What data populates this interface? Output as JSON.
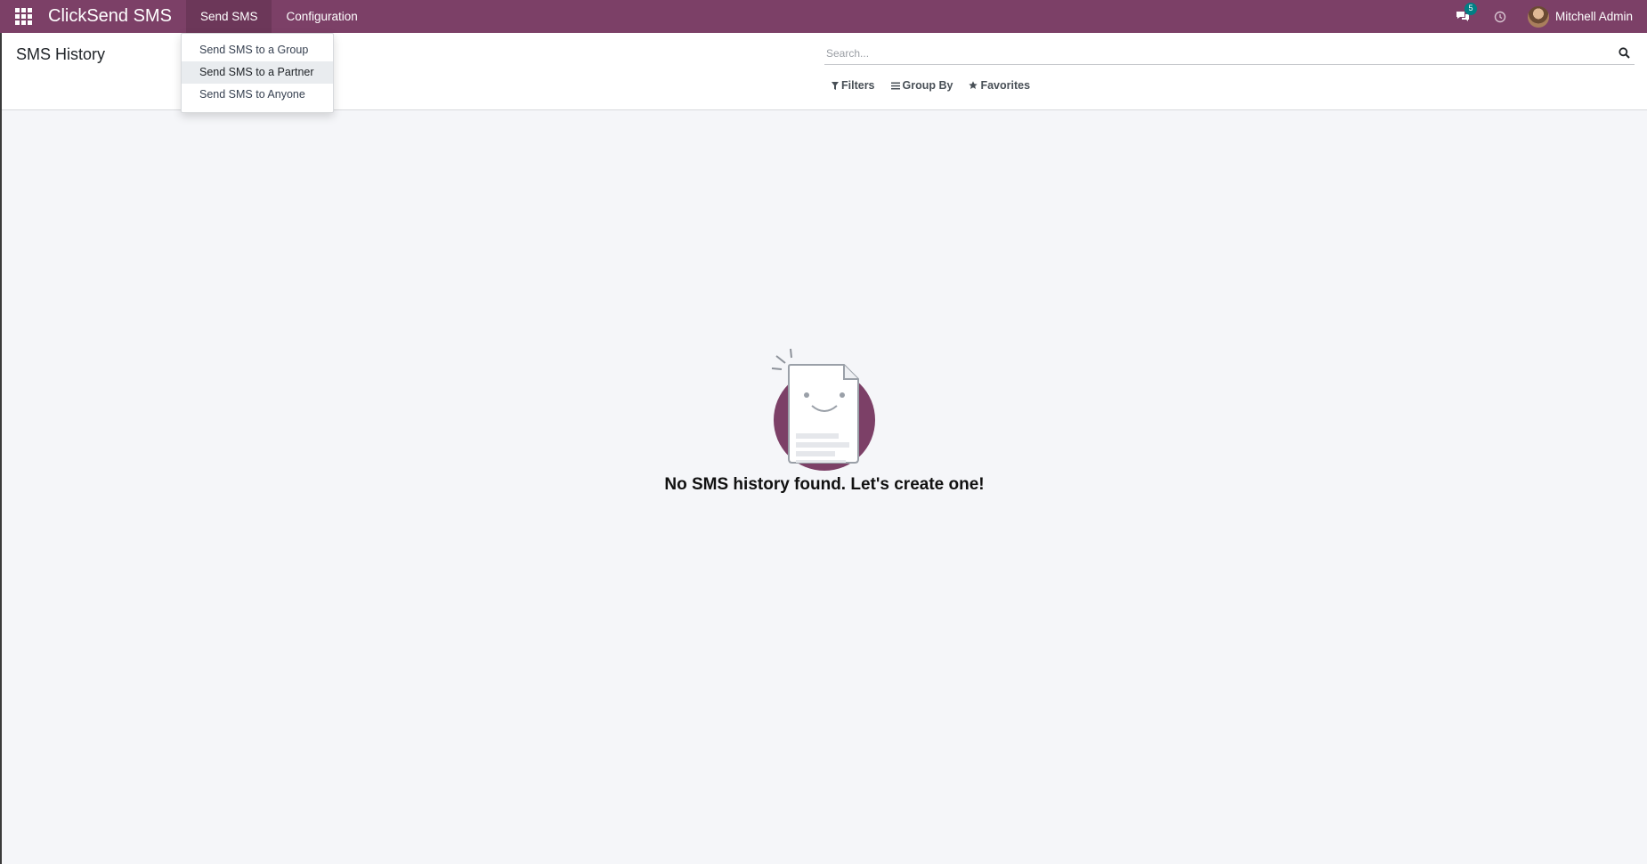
{
  "app": {
    "brand": "ClickSend SMS"
  },
  "navbar": {
    "menu": [
      {
        "label": "Send SMS"
      },
      {
        "label": "Configuration"
      }
    ],
    "messages_badge": "5",
    "user_name": "Mitchell Admin",
    "accent_color": "#7c4067"
  },
  "dropdown": {
    "items": [
      {
        "label": "Send SMS to a Group"
      },
      {
        "label": "Send SMS to a Partner"
      },
      {
        "label": "Send SMS to Anyone"
      }
    ]
  },
  "control_panel": {
    "title": "SMS History",
    "search_placeholder": "Search...",
    "filters_label": "Filters",
    "groupby_label": "Group By",
    "favorites_label": "Favorites"
  },
  "empty_state": {
    "message": "No SMS history found. Let's create one!"
  },
  "icons": [
    "apps-grid-icon",
    "chat-icon",
    "clock-icon",
    "search-icon",
    "filter-icon",
    "group-by-icon",
    "star-icon"
  ]
}
